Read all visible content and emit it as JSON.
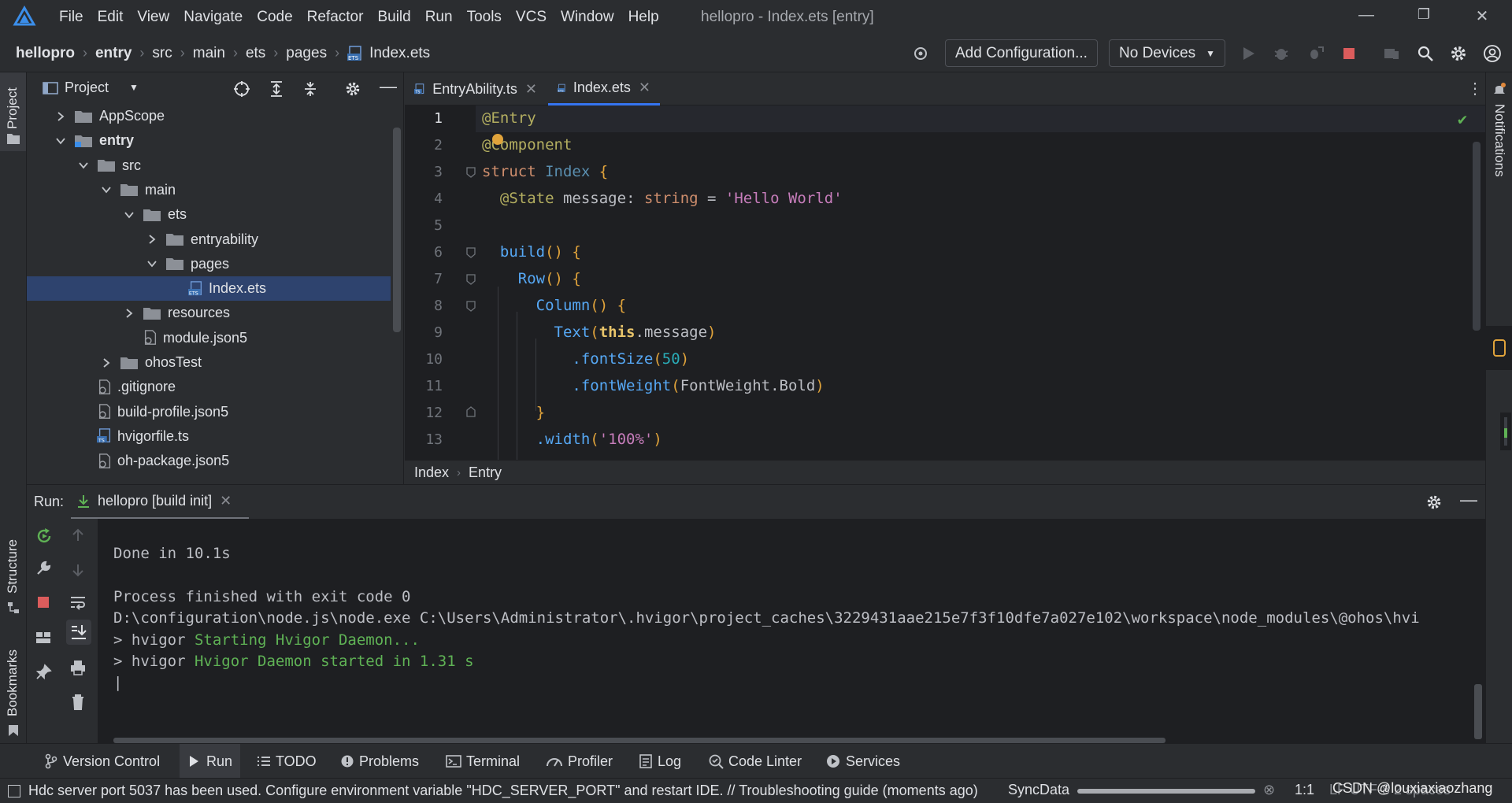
{
  "menu": [
    "File",
    "Edit",
    "View",
    "Navigate",
    "Code",
    "Refactor",
    "Build",
    "Run",
    "Tools",
    "VCS",
    "Window",
    "Help"
  ],
  "window_title": "hellopro - Index.ets [entry]",
  "breadcrumb": [
    "hellopro",
    "entry",
    "src",
    "main",
    "ets",
    "pages",
    "Index.ets"
  ],
  "toolbar": {
    "add_config": "Add Configuration...",
    "devices": "No Devices"
  },
  "left_stripe": {
    "project": "Project",
    "structure": "Structure",
    "bookmarks": "Bookmarks"
  },
  "right_stripe": {
    "notifications": "Notifications"
  },
  "project_panel": {
    "title": "Project",
    "tree": [
      {
        "label": "AppScope",
        "type": "folder",
        "depth": 0,
        "expanded": false
      },
      {
        "label": "entry",
        "type": "module",
        "depth": 0,
        "expanded": true,
        "bold": true
      },
      {
        "label": "src",
        "type": "folder",
        "depth": 1,
        "expanded": true
      },
      {
        "label": "main",
        "type": "folder",
        "depth": 2,
        "expanded": true
      },
      {
        "label": "ets",
        "type": "folder",
        "depth": 3,
        "expanded": true
      },
      {
        "label": "entryability",
        "type": "folder",
        "depth": 4,
        "expanded": false
      },
      {
        "label": "pages",
        "type": "folder",
        "depth": 4,
        "expanded": true
      },
      {
        "label": "Index.ets",
        "type": "ets",
        "depth": 5,
        "selected": true
      },
      {
        "label": "resources",
        "type": "folder",
        "depth": 3,
        "expanded": false
      },
      {
        "label": "module.json5",
        "type": "json",
        "depth": 3
      },
      {
        "label": "ohosTest",
        "type": "folder",
        "depth": 2,
        "expanded": false
      },
      {
        "label": ".gitignore",
        "type": "text",
        "depth": 1
      },
      {
        "label": "build-profile.json5",
        "type": "json",
        "depth": 1
      },
      {
        "label": "hvigorfile.ts",
        "type": "ts",
        "depth": 1
      },
      {
        "label": "oh-package.json5",
        "type": "json",
        "depth": 1
      }
    ]
  },
  "editor_tabs": [
    {
      "label": "EntryAbility.ts",
      "active": false
    },
    {
      "label": "Index.ets",
      "active": true
    }
  ],
  "code": {
    "line_numbers": [
      "1",
      "2",
      "3",
      "4",
      "5",
      "6",
      "7",
      "8",
      "9",
      "10",
      "11",
      "12",
      "13"
    ],
    "l1": "@Entry",
    "l2": "@Component",
    "l3_kw": "struct",
    "l3_name": "Index",
    "l4_ann": "@State",
    "l4_name": "message",
    "l4_type": "string",
    "l4_val": "'Hello World'",
    "l6": "build",
    "l7": "Row",
    "l8": "Column",
    "l9_fn": "Text",
    "l9_this": "this",
    "l9_prop": "message",
    "l10_fn": ".fontSize",
    "l10_val": "50",
    "l11_fn": ".fontWeight",
    "l11_arg": "FontWeight.Bold",
    "l13_fn": ".width",
    "l13_val": "'100%'"
  },
  "editor_crumbs": [
    "Index",
    "Entry"
  ],
  "run_panel": {
    "label": "Run:",
    "tab": "hellopro [build init]",
    "console": [
      "Done in 10.1s",
      "",
      "Process finished with exit code 0",
      "D:\\configuration\\node.js\\node.exe C:\\Users\\Administrator\\.hvigor\\project_caches\\3229431aae215e7f3f10dfe7a027e102\\workspace\\node_modules\\@ohos\\hvi",
      "> hvigor ",
      "> hvigor ",
      "|"
    ],
    "console_green_1": "Starting Hvigor Daemon...",
    "console_green_2": "Hvigor Daemon started in 1.31 s"
  },
  "tool_tabs": [
    "Version Control",
    "Run",
    "TODO",
    "Problems",
    "Terminal",
    "Profiler",
    "Log",
    "Code Linter",
    "Services"
  ],
  "status": {
    "message": "Hdc server port 5037 has been used. Configure environment variable \"HDC_SERVER_PORT\" and restart IDE. // Troubleshooting guide (moments ago)",
    "sync": "SyncData",
    "position": "1:1",
    "encoding": "LF  UTF-8  2 spaces",
    "watermark": "CSDN @louxiaxiaozhang"
  },
  "colors": {
    "accent": "#3574f0",
    "selection": "#2e436e",
    "stop": "#db5c5c",
    "green": "#5fb255"
  }
}
